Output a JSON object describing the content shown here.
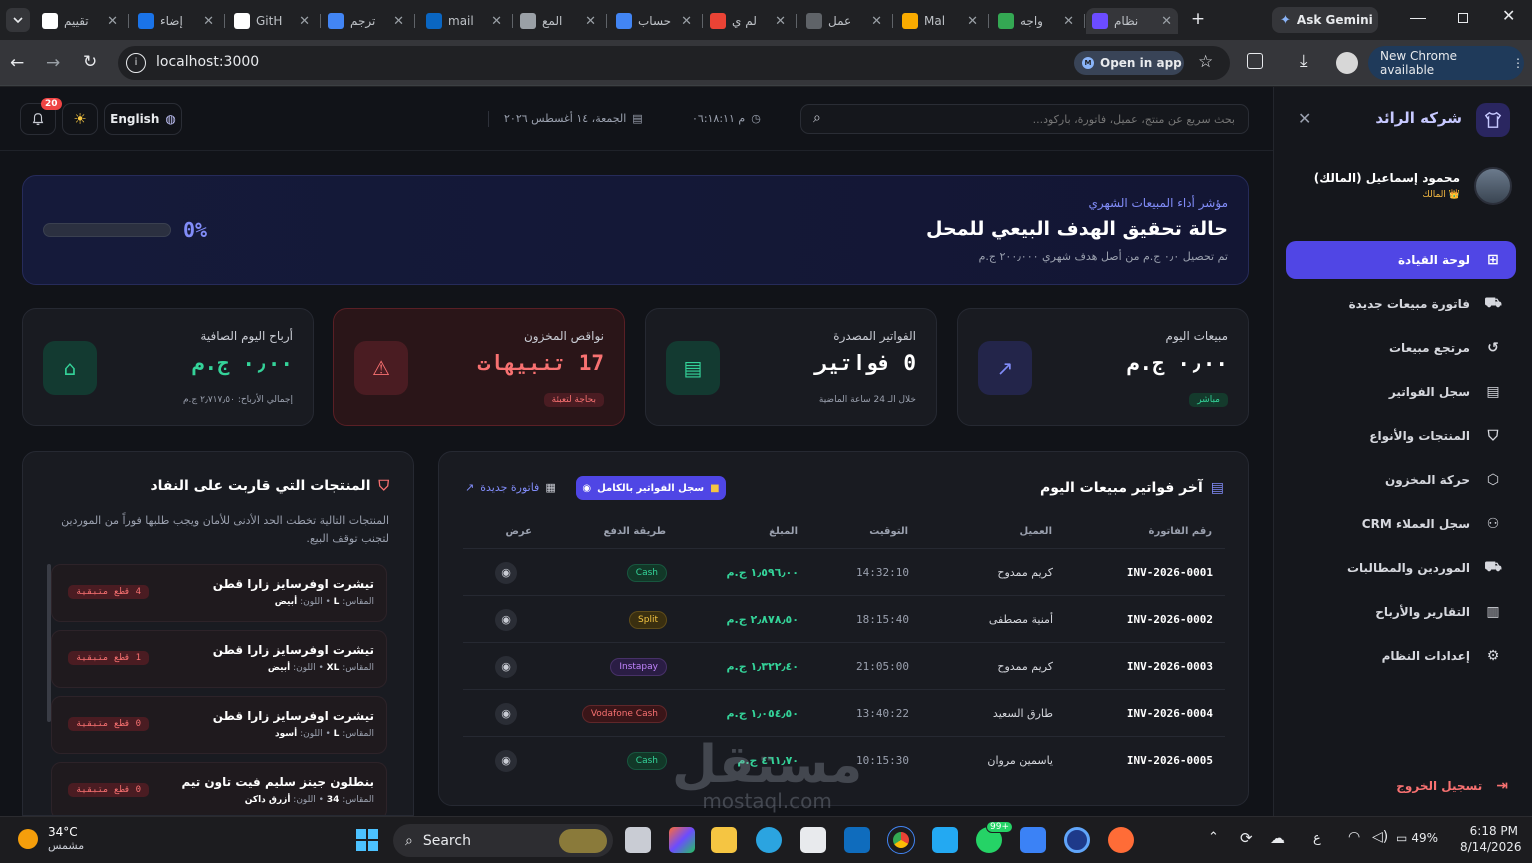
{
  "browser": {
    "tabs": [
      {
        "title": "تقييم",
        "fav": "openai-icon",
        "color": "#ffffff"
      },
      {
        "title": "إضاء",
        "fav": "circle-icon",
        "color": "#1a73e8"
      },
      {
        "title": "GitH",
        "fav": "github-icon",
        "color": "#ffffff"
      },
      {
        "title": "ترجم",
        "fav": "google-icon",
        "color": "#4285f4"
      },
      {
        "title": "mail",
        "fav": "linkedin-icon",
        "color": "#0a66c2"
      },
      {
        "title": "المع",
        "fav": "slash-icon",
        "color": "#9aa0a6"
      },
      {
        "title": "حساب",
        "fav": "google-icon",
        "color": "#4285f4"
      },
      {
        "title": "لم ي",
        "fav": "gmail-icon",
        "color": "#ea4335"
      },
      {
        "title": "عمل",
        "fav": "bars-icon",
        "color": "#5f6368"
      },
      {
        "title": "Mal",
        "fav": "b-icon",
        "color": "#f9ab00"
      },
      {
        "title": "واجه",
        "fav": "green-dot-icon",
        "color": "#34a853"
      },
      {
        "title": "نظام",
        "fav": "purple-shirt-icon",
        "color": "#6c4cff"
      }
    ],
    "ask_gemini": "Ask Gemini",
    "url": "localhost:3000",
    "open_in_app": "Open in app",
    "new_chrome": "New Chrome available"
  },
  "header": {
    "notif_count": "20",
    "lang_button": "English",
    "datetime": "الجمعة، ١٤ أغسطس ٢٠٢٦",
    "time": "م ٠٦:١٨:١١",
    "search_placeholder": "بحث سريع عن منتج، عميل، فاتورة، باركود..."
  },
  "sidebar": {
    "company": "شركه الرائد",
    "user_name": "محمود إسماعيل (المالك)",
    "user_role": "المالك",
    "items": [
      {
        "label": "لوحة القيادة",
        "icon": "dashboard-icon",
        "active": true
      },
      {
        "label": "فاتورة مبيعات جديدة",
        "icon": "cart-icon"
      },
      {
        "label": "مرتجع مبيعات",
        "icon": "return-icon"
      },
      {
        "label": "سجل الفواتير",
        "icon": "document-icon"
      },
      {
        "label": "المنتجات والأنواع",
        "icon": "shirt-icon"
      },
      {
        "label": "حركة المخزون",
        "icon": "box-icon"
      },
      {
        "label": "سجل العملاء CRM",
        "icon": "users-icon"
      },
      {
        "label": "الموردين والمطالبات",
        "icon": "truck-icon"
      },
      {
        "label": "التقارير والأرباح",
        "icon": "chart-icon"
      },
      {
        "label": "إعدادات النظام",
        "icon": "gear-icon"
      }
    ],
    "logout": "تسجيل الخروج"
  },
  "target": {
    "kicker": "مؤشر أداء المبيعات الشهري",
    "title": "حالة تحقيق الهدف البيعي للمحل",
    "subtitle": "تم تحصيل ٠٫٠ ج.م من أصل هدف شهري ٢٠٠٫٠٠٠ ج.م",
    "percent_label": "0%",
    "progress": 0
  },
  "kpis": [
    {
      "title": "مبيعات اليوم",
      "value": "٠٫٠٠ ج.م",
      "note": "مباشر",
      "color": "#818cf8"
    },
    {
      "title": "الفواتير المصدرة",
      "value": "0 فواتير",
      "note": "خلال الـ 24 ساعة الماضية",
      "color": "#34d399"
    },
    {
      "title": "نواقص المخزون",
      "value": "17 تنبيهات",
      "note": "بحاجة لتعبئة",
      "color": "#f87171"
    },
    {
      "title": "أرباح اليوم الصافية",
      "value": "٠٫٠٠ ج.م",
      "note": "إجمالي الأرباح: ٢٫٧١٧٫٥٠ ج.م",
      "color": "#34d399"
    }
  ],
  "invoices": {
    "title": "آخر فواتير مبيعات اليوم",
    "view_all": "سجل الفواتير بالكامل",
    "new_invoice": "فاتورة جديدة",
    "columns": [
      "رقم الفاتورة",
      "العميل",
      "التوقيت",
      "المبلغ",
      "طريقة الدفع",
      "عرض"
    ],
    "rows": [
      {
        "id": "INV-2026-0001",
        "customer": "كريم ممدوح",
        "time": "14:32:10",
        "amount": "١٫٥٩٦٫٠٠ ج.م",
        "method": "Cash"
      },
      {
        "id": "INV-2026-0002",
        "customer": "أمنية مصطفى",
        "time": "18:15:40",
        "amount": "٢٫٨٧٨٫٥٠ ج.م",
        "method": "Split"
      },
      {
        "id": "INV-2026-0003",
        "customer": "كريم ممدوح",
        "time": "21:05:00",
        "amount": "١٫٣٢٢٫٤٠ ج.م",
        "method": "Instapay"
      },
      {
        "id": "INV-2026-0004",
        "customer": "طارق السعيد",
        "time": "13:40:22",
        "amount": "١٫٠٥٤٫٥٠ ج.م",
        "method": "Vodafone Cash"
      },
      {
        "id": "INV-2026-0005",
        "customer": "ياسمين مروان",
        "time": "10:15:30",
        "amount": "٤٦١٫٧٠ ج.م",
        "method": "Cash"
      }
    ]
  },
  "lowstock": {
    "title": "المنتجات التي قاربت على النفاد",
    "desc": "المنتجات التالية تخطت الحد الأدنى للأمان ويجب طلبها فوراً من الموردين لتجنب توقف البيع.",
    "items": [
      {
        "name": "تيشرت اوفرسايز زارا قطن",
        "size_label": "المقاس:",
        "size": "L",
        "color_label": "اللون:",
        "color": "أبيض",
        "badge": "4 قطع متبقية"
      },
      {
        "name": "تيشرت اوفرسايز زارا قطن",
        "size_label": "المقاس:",
        "size": "XL",
        "color_label": "اللون:",
        "color": "أبيض",
        "badge": "1 قطع متبقية"
      },
      {
        "name": "تيشرت اوفرسايز زارا قطن",
        "size_label": "المقاس:",
        "size": "L",
        "color_label": "اللون:",
        "color": "أسود",
        "badge": "0 قطع متبقية"
      },
      {
        "name": "بنطلون جينز سليم فيت تاون تيم",
        "size_label": "المقاس:",
        "size": "34",
        "color_label": "اللون:",
        "color": "أزرق داكن",
        "badge": "0 قطع متبقية"
      }
    ]
  },
  "watermark": {
    "main": "مستقل",
    "sub": "mostaql.com"
  },
  "taskbar": {
    "weather_temp": "34°C",
    "weather_desc": "مشمس",
    "search": "Search",
    "battery": "49%",
    "lang": "ع",
    "time": "6:18 PM",
    "date": "8/14/2026",
    "whatsapp_badge": "99+"
  }
}
